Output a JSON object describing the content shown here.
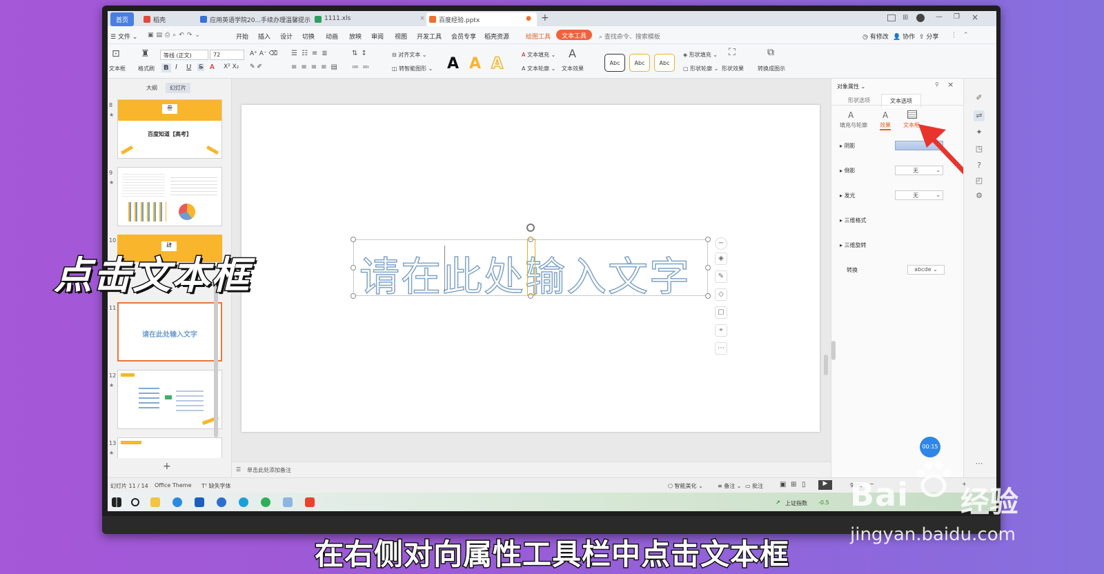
{
  "tabs": [
    {
      "label": "首页",
      "color": "#4a7fe0"
    },
    {
      "label": "稻壳",
      "color": "#e04a3c"
    },
    {
      "label": "应用英语学院20...手续办理温馨提示",
      "color": "#3c6fd6"
    },
    {
      "label": "1111.xls",
      "color": "#2e9e5e"
    },
    {
      "label": "百度经验.pptx",
      "color": "#f07030"
    }
  ],
  "menu": {
    "file": "文件",
    "items": [
      "开始",
      "插入",
      "设计",
      "切换",
      "动画",
      "放映",
      "审阅",
      "视图",
      "开发工具",
      "会员专享",
      "稻壳资源",
      "绘图工具"
    ],
    "active_pill": "文本工具",
    "search": "查找命令、搜索模板",
    "right": [
      "有修改",
      "协作",
      "分享"
    ]
  },
  "toolbar": {
    "textbox": "文本框",
    "format_painter": "格式刷",
    "font_name": "等线 (正文)",
    "font_size": "72",
    "align_text": "对齐文本",
    "smart_shape": "转智能图形",
    "text_fill": "文本填充",
    "text_outline": "文本轮廓",
    "text_effect": "文本效果",
    "style_boxes": [
      "Abc",
      "Abc",
      "Abc"
    ],
    "shape_fill": "形状填充",
    "shape_outline": "形状轮廓",
    "shape_effect": "形状效果",
    "convert_to_graphic": "转换成图示"
  },
  "left_panel": {
    "tabs": [
      "大纲",
      "幻灯片"
    ],
    "slides": [
      {
        "num": "8",
        "title": "百度知道【高考】",
        "badge": "叁"
      },
      {
        "num": "9"
      },
      {
        "num": "10",
        "badge": "肆"
      },
      {
        "num": "11",
        "title": "请在此处输入文字"
      },
      {
        "num": "12"
      },
      {
        "num": "13"
      }
    ],
    "add": "+"
  },
  "canvas": {
    "placeholder_text": "请在此处输入文字",
    "notes": "单击此处添加备注"
  },
  "right_panel": {
    "title": "对象属性",
    "tabs": [
      "形状选项",
      "文本选项"
    ],
    "subtabs": [
      "填充与轮廓",
      "效果",
      "文本框"
    ],
    "rows": [
      {
        "label": "阴影",
        "value": ""
      },
      {
        "label": "倒影",
        "value": "无"
      },
      {
        "label": "发光",
        "value": "无"
      },
      {
        "label": "三维格式",
        "value": ""
      },
      {
        "label": "三维旋转",
        "value": ""
      }
    ],
    "transform_label": "转换",
    "transform_value": "abcde",
    "timer": "00:15"
  },
  "statusbar": {
    "slide_info": "幻灯片 11 / 14",
    "theme": "Office Theme",
    "missing_font": "缺失字体",
    "beautify": "智能美化",
    "notes": "备注",
    "comments": "批注",
    "zoom": "99%"
  },
  "taskbar": {
    "stock_label": "上证指数",
    "stock_value": "-0.5"
  },
  "overlay": {
    "left_caption": "点击文本框",
    "subtitle": "在右侧对向属性工具栏中点击文本框",
    "watermark_brand": "Bai",
    "watermark_jingyan": "经验",
    "watermark_url": "jingyan.baidu.com"
  },
  "colors": {
    "accent": "#f0623a",
    "arrow": "#e8342c",
    "thumb_yellow": "#f9b52b",
    "text_blue": "#6f9dd0"
  }
}
